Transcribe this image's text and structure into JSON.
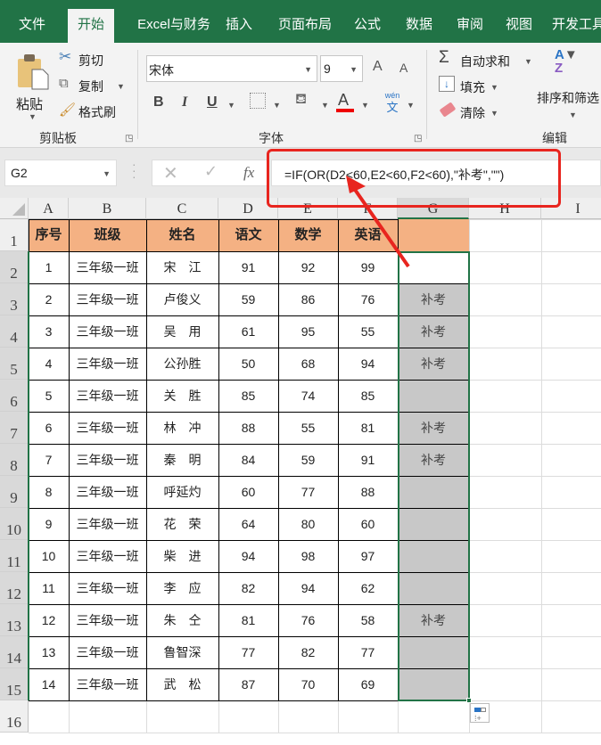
{
  "tabs": [
    {
      "label": "文件"
    },
    {
      "label": "开始",
      "active": true
    },
    {
      "label": "Excel与财务"
    },
    {
      "label": "插入"
    },
    {
      "label": "页面布局"
    },
    {
      "label": "公式"
    },
    {
      "label": "数据"
    },
    {
      "label": "审阅"
    },
    {
      "label": "视图"
    },
    {
      "label": "开发工具"
    }
  ],
  "ribbon": {
    "clipboard": {
      "paste": "粘贴",
      "cut": "剪切",
      "copy": "复制",
      "format_painter": "格式刷",
      "group": "剪贴板"
    },
    "font": {
      "name": "宋体",
      "size": "9",
      "bold": "B",
      "italic": "I",
      "underline": "U",
      "phonetic_top": "wén",
      "phonetic_bottom": "文",
      "font_color": "A",
      "grow": "A",
      "shrink": "A",
      "group": "字体"
    },
    "editing": {
      "autosum": "自动求和",
      "fill": "填充",
      "clear": "清除",
      "sort_filter": "排序和筛选",
      "group": "编辑"
    }
  },
  "formula_bar": {
    "name_box": "G2",
    "fx": "fx",
    "formula": "=IF(OR(D2<60,E2<60,F2<60),\"补考\",\"\")"
  },
  "columns": [
    "A",
    "B",
    "C",
    "D",
    "E",
    "F",
    "G",
    "H",
    "I"
  ],
  "rows": [
    "1",
    "2",
    "3",
    "4",
    "5",
    "6",
    "7",
    "8",
    "9",
    "10",
    "11",
    "12",
    "13",
    "14",
    "15",
    "16"
  ],
  "table": {
    "headers": [
      "序号",
      "班级",
      "姓名",
      "语文",
      "数学",
      "英语",
      ""
    ],
    "records": [
      [
        "1",
        "三年级一班",
        "宋　江",
        "91",
        "92",
        "99",
        ""
      ],
      [
        "2",
        "三年级一班",
        "卢俊义",
        "59",
        "86",
        "76",
        "补考"
      ],
      [
        "3",
        "三年级一班",
        "吴　用",
        "61",
        "95",
        "55",
        "补考"
      ],
      [
        "4",
        "三年级一班",
        "公孙胜",
        "50",
        "68",
        "94",
        "补考"
      ],
      [
        "5",
        "三年级一班",
        "关　胜",
        "85",
        "74",
        "85",
        ""
      ],
      [
        "6",
        "三年级一班",
        "林　冲",
        "88",
        "55",
        "81",
        "补考"
      ],
      [
        "7",
        "三年级一班",
        "秦　明",
        "84",
        "59",
        "91",
        "补考"
      ],
      [
        "8",
        "三年级一班",
        "呼延灼",
        "60",
        "77",
        "88",
        ""
      ],
      [
        "9",
        "三年级一班",
        "花　荣",
        "64",
        "80",
        "60",
        ""
      ],
      [
        "10",
        "三年级一班",
        "柴　进",
        "94",
        "98",
        "97",
        ""
      ],
      [
        "11",
        "三年级一班",
        "李　应",
        "82",
        "94",
        "62",
        ""
      ],
      [
        "12",
        "三年级一班",
        "朱　仝",
        "81",
        "76",
        "58",
        "补考"
      ],
      [
        "13",
        "三年级一班",
        "鲁智深",
        "77",
        "82",
        "77",
        ""
      ],
      [
        "14",
        "三年级一班",
        "武　松",
        "87",
        "70",
        "69",
        ""
      ]
    ]
  },
  "colors": {
    "accent": "#217346",
    "header_fill": "#f4b183",
    "selection_fill": "#c8c8c8",
    "annotation": "#e8251f"
  }
}
